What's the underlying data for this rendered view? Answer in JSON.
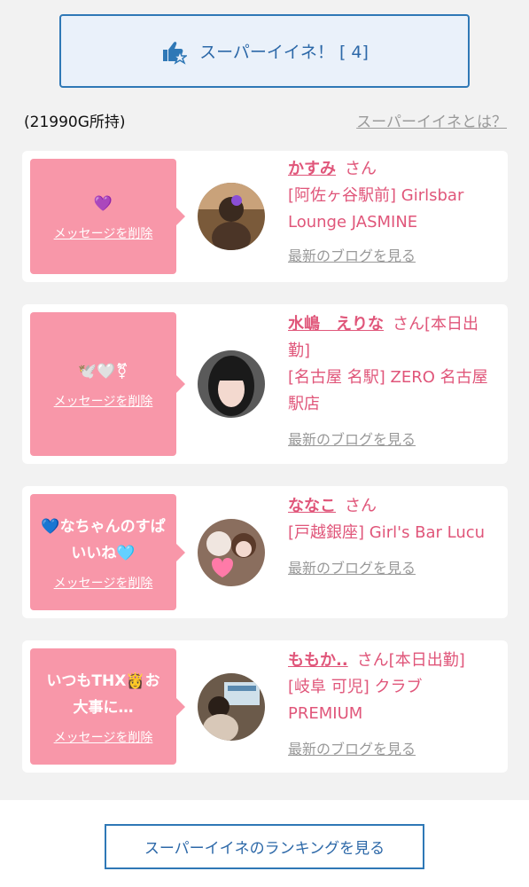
{
  "super_button": {
    "label": "スーパーイイネ！ [ 4]",
    "icon": "thumbs-up-star-icon"
  },
  "points": "(21990G所持)",
  "about_link": "スーパーイイネとは？",
  "cards": [
    {
      "message": "💜",
      "delete_label": "メッセージを削除",
      "name": "かすみ",
      "san": "さん",
      "shop": "[阿佐ヶ谷駅前] Girlsbar Lounge JASMINE",
      "blog": "最新のブログを見る"
    },
    {
      "message": "🕊️🤍⚧",
      "delete_label": "メッセージを削除",
      "name": "水嶋　えりな",
      "san": "さん[本日出勤]",
      "shop": "[名古屋 名駅] ZERO 名古屋駅店",
      "blog": "最新のブログを見る"
    },
    {
      "message": "💙なちゃんのすぱいいね🩵",
      "delete_label": "メッセージを削除",
      "name": "ななこ",
      "san": "さん",
      "shop": "[戸越銀座] Girl's Bar Lucu",
      "blog": "最新のブログを見る"
    },
    {
      "message": "いつもTHX👸お大事に…",
      "delete_label": "メッセージを削除",
      "name": "ももか..",
      "san": "さん[本日出勤]",
      "shop": "[岐阜 可児] クラブ PREMIUM",
      "blog": "最新のブログを見る"
    }
  ],
  "ranking_button": "スーパーイイネのランキングを見る",
  "colors": {
    "accent_blue": "#2f78b6",
    "bubble_pink": "#f897a9",
    "name_pink": "#e0567a"
  }
}
